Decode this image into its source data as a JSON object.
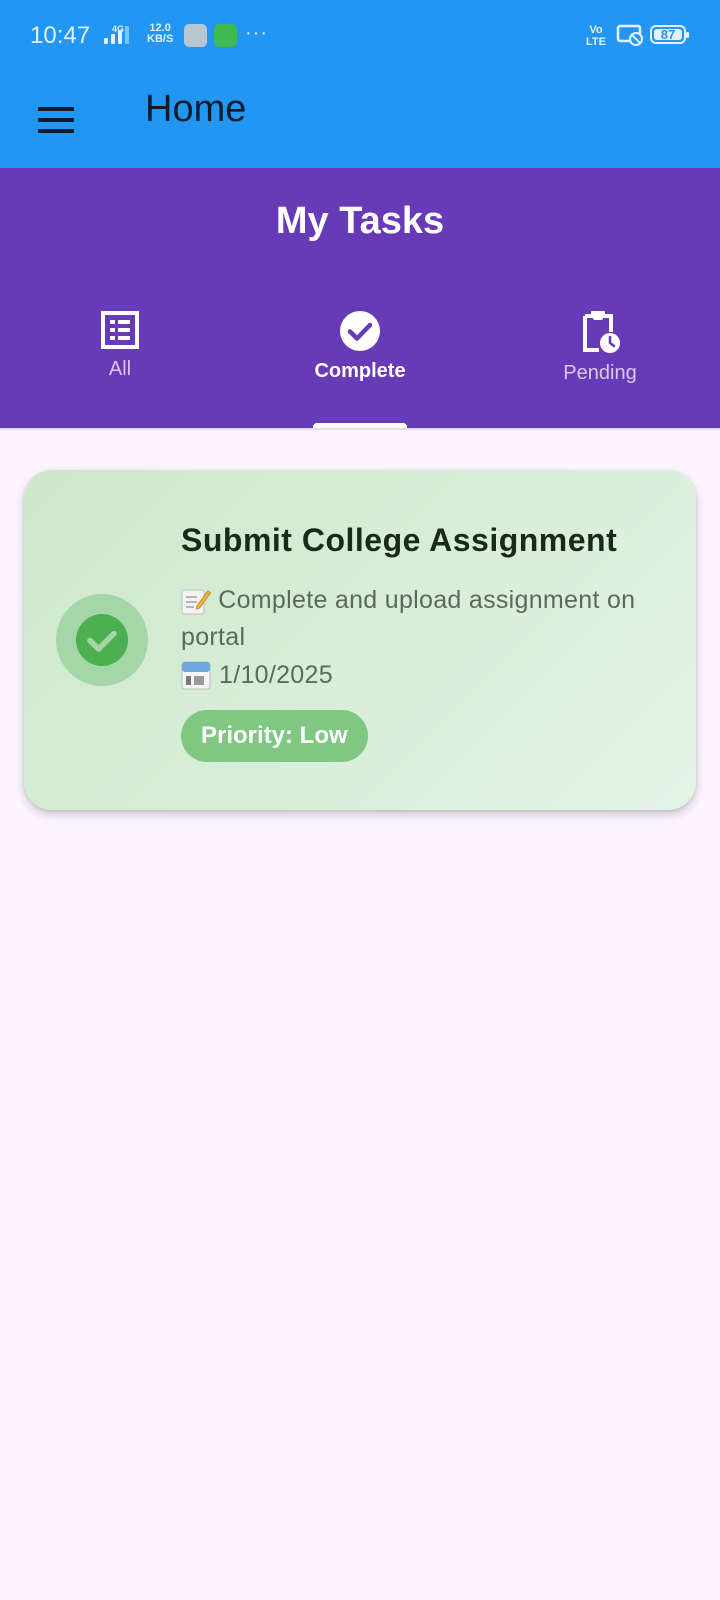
{
  "status_bar": {
    "time": "10:47",
    "network_label": "4G",
    "speed_value": "12.0",
    "speed_unit": "KB/S",
    "overflow": "···",
    "volte_top": "Vo",
    "volte_bottom": "LTE",
    "battery_level": "87"
  },
  "app_bar": {
    "menu_icon": "hamburger-menu-icon",
    "title": "Home"
  },
  "tasks_header": {
    "title": "My Tasks",
    "tabs": [
      {
        "label": "All",
        "icon": "list-icon",
        "active": false
      },
      {
        "label": "Complete",
        "icon": "check-circle-icon",
        "active": true
      },
      {
        "label": "Pending",
        "icon": "clipboard-clock-icon",
        "active": false
      }
    ]
  },
  "task_card": {
    "status_icon": "check-circle-icon",
    "title": "Submit College Assignment",
    "description_icon": "memo-icon",
    "description": "Complete and upload assignment on portal",
    "date_icon": "calendar-icon",
    "date": "1/10/2025",
    "priority_label": "Priority: Low"
  },
  "colors": {
    "app_bar": "#2196f3",
    "tasks_header": "#673ab7",
    "background": "#fcf5fe",
    "card_gradient_start": "#cde8cb",
    "card_gradient_end": "#e4f3e5",
    "status_check": "#4caf50",
    "priority_low": "#81c784"
  }
}
